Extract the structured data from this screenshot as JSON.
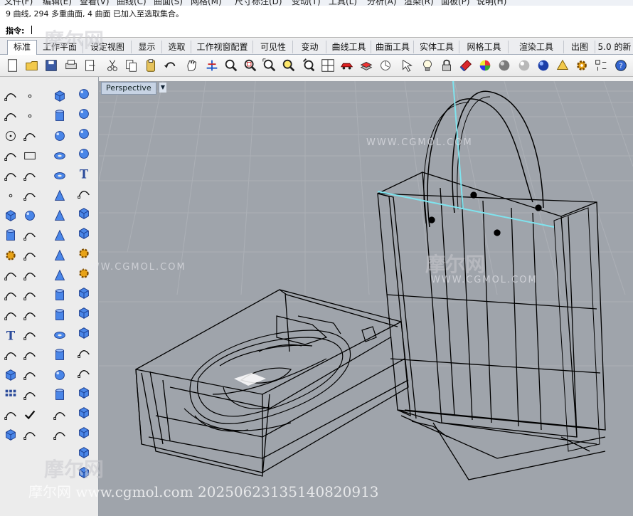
{
  "menu": [
    "文件(F)",
    "编辑(E)",
    "查看(V)",
    "曲线(C)",
    "曲面(S)",
    "网格(M)",
    "尺寸标注(D)",
    "变动(T)",
    "工具(L)",
    "分析(A)",
    "渲染(R)",
    "面板(P)",
    "说明(H)"
  ],
  "history": {
    "line": "9 曲线, 294 多重曲面, 4 曲面 已加入至选取集合。"
  },
  "command": {
    "label": "指令:",
    "value": ""
  },
  "tabs": [
    "标准",
    "工作平面",
    "设定视图",
    "显示",
    "选取",
    "工作视窗配置",
    "可见性",
    "变动",
    "曲线工具",
    "曲面工具",
    "实体工具",
    "网格工具",
    "渲染工具",
    "出图",
    "5.0 的新"
  ],
  "toolbar_icons": [
    "new-file-icon",
    "open-folder-icon",
    "save-icon",
    "print-icon",
    "import-icon",
    "cut-icon",
    "copy-icon",
    "paste-icon",
    "undo-icon",
    "pan-hand-icon",
    "rotate-view-icon",
    "zoom-icon",
    "zoom-window-icon",
    "zoom-extents-icon",
    "zoom-selected-icon",
    "undo-view-icon",
    "four-viewports-icon",
    "car-icon",
    "layers-icon",
    "object-properties-icon",
    "select-icon",
    "light-bulb-icon",
    "lock-icon",
    "material-icon",
    "color-wheel-icon",
    "render-sphere-gray-icon",
    "render-sphere-white-icon",
    "render-sphere-blue-icon",
    "mesh-icon",
    "gear-icon",
    "options-icon",
    "help-icon"
  ],
  "viewport": {
    "title": "Perspective"
  },
  "watermarks": {
    "brand_cn": "摩尔网",
    "site": "WWW.CGMOL.COM",
    "footer": "摩尔网 www.cgmol.com 20250623135140820913"
  },
  "colors": {
    "viewport_bg": "#9fa4ab",
    "wire": "#000000",
    "selected_edge": "#7fe3ee"
  }
}
